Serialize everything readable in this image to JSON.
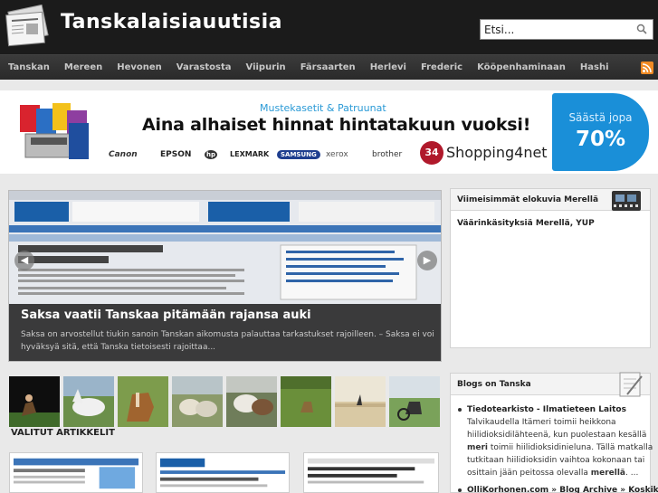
{
  "site": {
    "title": "Tanskalaisiauutisia"
  },
  "search": {
    "placeholder": "Etsi..."
  },
  "nav": [
    "Tanskan",
    "Mereen",
    "Hevonen",
    "Varastosta",
    "Viipurin",
    "Färsaarten",
    "Herlevi",
    "Frederic",
    "Kööpenhaminaan",
    "Hashi"
  ],
  "banner": {
    "subtitle": "Mustekasetit & Patruunat",
    "headline": "Aina alhaiset hinnat hintatakuun vuoksi!",
    "brands": [
      "Canon",
      "EPSON",
      "hp",
      "LEXMARK",
      "SAMSUNG",
      "xerox",
      "brother"
    ],
    "shop_badge": "34",
    "shop_name": "Shopping4net",
    "sale_label": "Säästä jopa",
    "sale_value": "70%"
  },
  "slider": {
    "title": "Saksa vaatii Tanskaa pitämään rajansa auki",
    "text": "Saksa on arvostellut tiukin sanoin Tanskan aikomusta palauttaa tarkastukset rajoilleen. – Saksa ei voi hyväksyä sitä, että Tanska tietoisesti rajoittaa..."
  },
  "selected_heading": "VALITUT ARTIKKELIT",
  "widgets": {
    "movies": {
      "title": "Viimeisimmät elokuvia Merellä",
      "link": "Väärinkäsityksiä Merellä, YUP"
    },
    "blogs": {
      "title": "Blogs on Tanska",
      "entries": [
        {
          "title": "Tiedotearkisto - Ilmatieteen Laitos",
          "text_before": "Talvikaudella Itämeri toimii heikkona hiilidioksidilähteenä, kun puolestaan kesällä ",
          "text_bold1": "meri",
          "text_middle": " toimii hiilidioksidinieluna. Tällä matkalla tutkitaan hiilidioksidin vaihtoa kokonaan tai osittain jään peitossa olevalla ",
          "text_bold2": "merellä",
          "text_after": ". ..."
        },
        {
          "title": "OlliKorhonen.com » Blog Archive » Koskikara"
        }
      ]
    }
  },
  "colors": {
    "header_bg": "#1b1b1b",
    "nav_bg": "#333333",
    "accent_blue": "#1a8fd8",
    "rss": "#f08a24"
  }
}
